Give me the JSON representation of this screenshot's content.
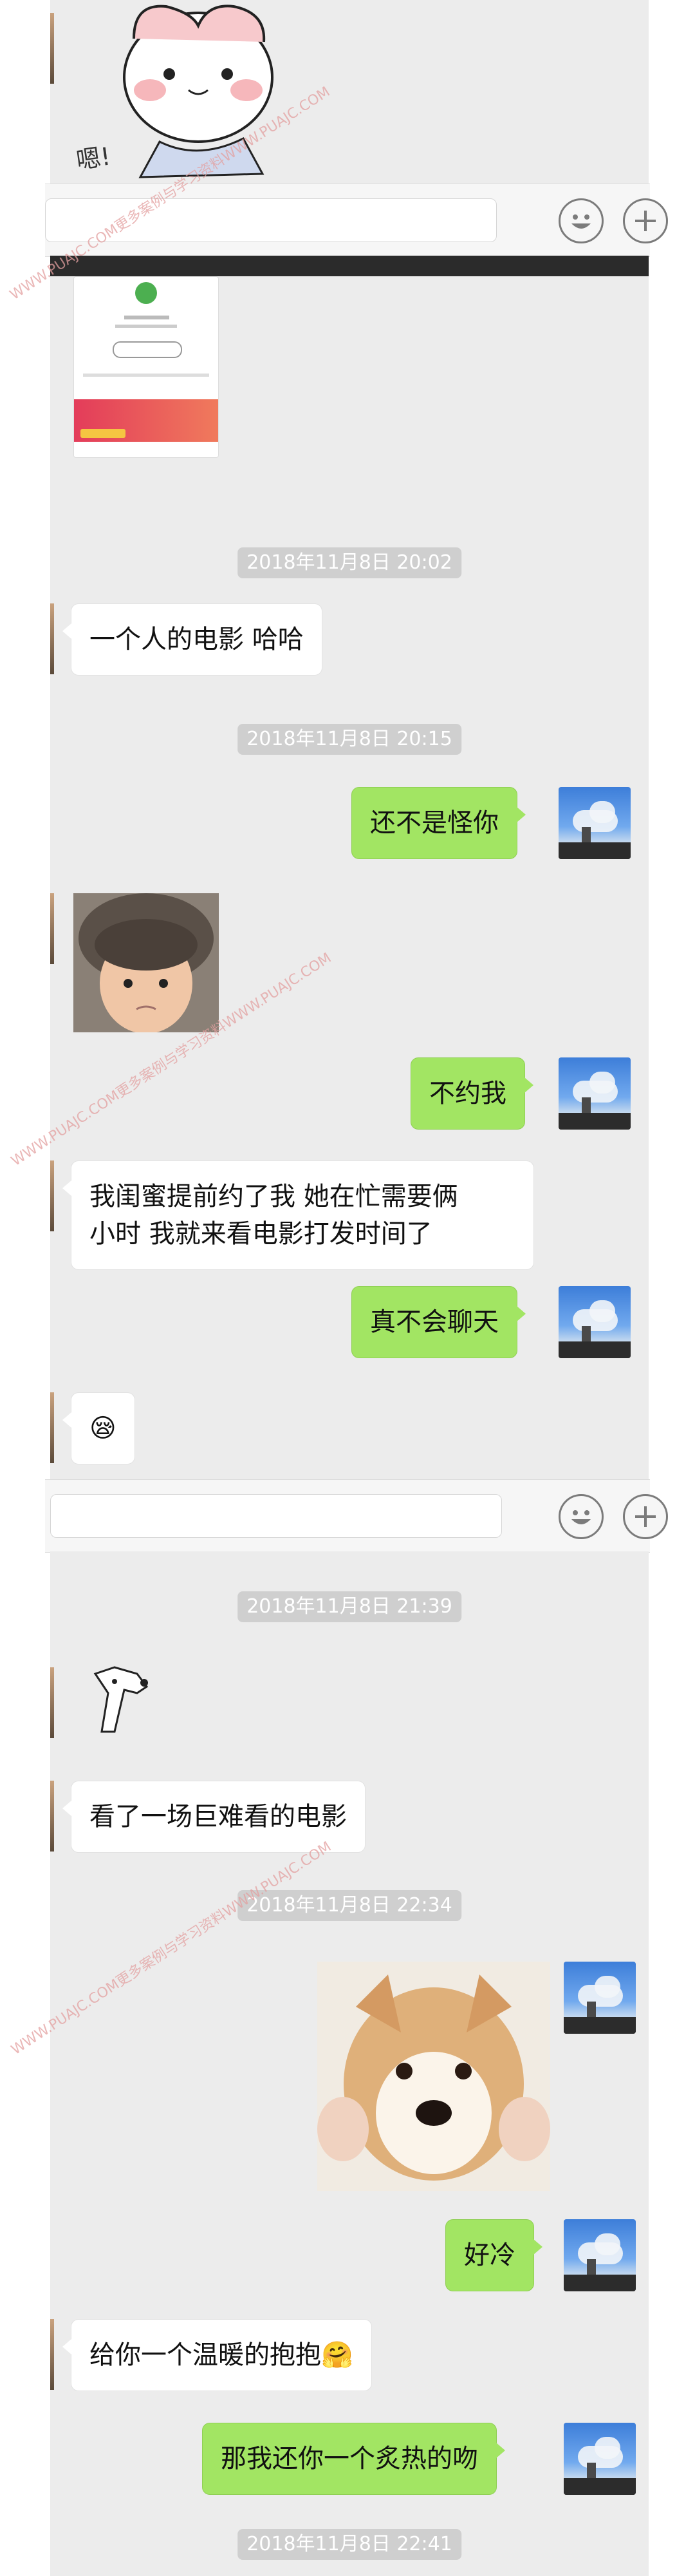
{
  "watermark_text": "WWW.PUAJC.COM更多案例与学习资料WWW.PUAJC.COM",
  "colors": {
    "chat_bg": "#ececec",
    "bubble_out": "#a2e563",
    "bubble_in": "#ffffff",
    "timestamp_bg": "#cfcfcf",
    "watermark": "#e3a0a0"
  },
  "sticker_top_text": "嗯!",
  "timestamps": {
    "t1": "2018年11月8日 20:02",
    "t2": "2018年11月8日 20:15",
    "t3": "2018年11月8日 21:39",
    "t4": "2018年11月8日 22:34",
    "t5": "2018年11月8日 22:41"
  },
  "messages": {
    "m1": "一个人的电影 哈哈",
    "m2": "还不是怪你",
    "m3": "不约我",
    "m4_line1": "我闺蜜提前约了我 她在忙需要俩",
    "m4_line2": "小时 我就来看电影打发时间了",
    "m5": "真不会聊天",
    "m6_emoji": "😪",
    "m7": "看了一场巨难看的电影",
    "m8": "好冷",
    "m9": "给你一个温暖的抱抱",
    "m9_emoji": "🤗",
    "m10": "那我还你一个炙热的吻"
  },
  "icons": {
    "emoji_button": "smiley-face-icon",
    "plus_button": "plus-circle-icon"
  }
}
